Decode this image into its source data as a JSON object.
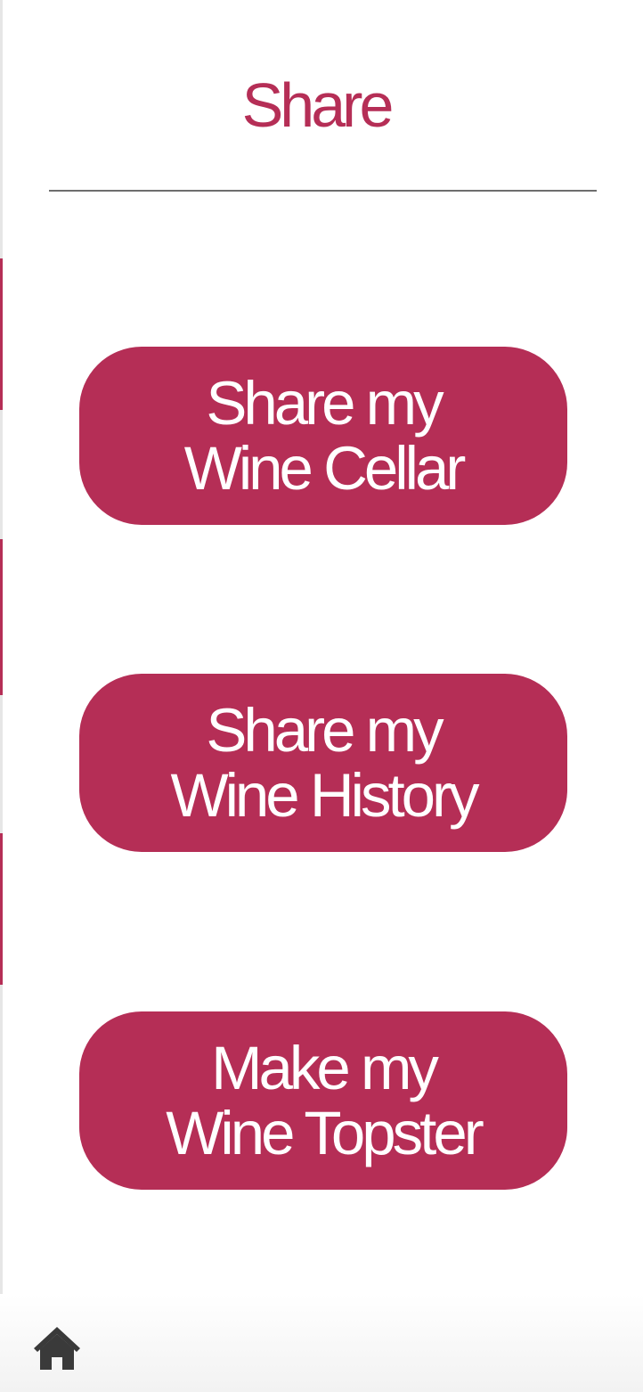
{
  "header": {
    "title": "Share"
  },
  "actions": [
    {
      "line1": "Share my",
      "line2": "Wine Cellar"
    },
    {
      "line1": "Share my",
      "line2": "Wine History"
    },
    {
      "line1": "Make my",
      "line2": "Wine Topster"
    }
  ],
  "nav": {
    "home_icon": "home-icon"
  },
  "colors": {
    "accent": "#b52e56",
    "divider": "#6e6e6e",
    "button_text": "#ffffff",
    "icon": "#3a3a3a",
    "background": "#ffffff"
  }
}
